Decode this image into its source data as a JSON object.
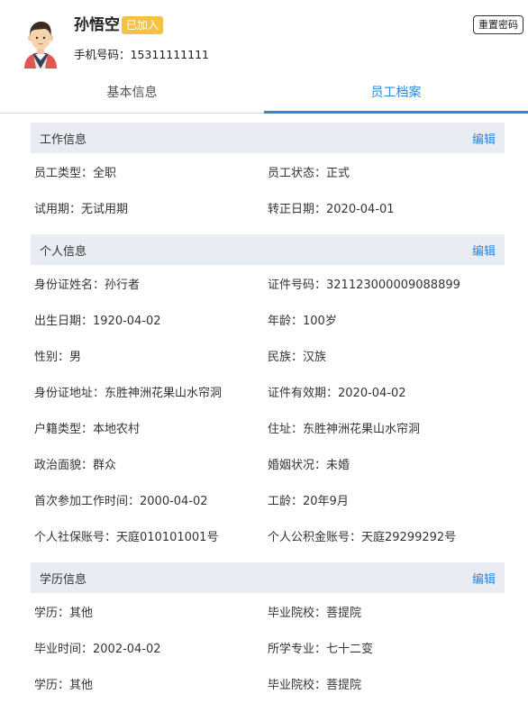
{
  "profile": {
    "name": "孙悟空",
    "badge": "已加入",
    "phone_label": "手机号码：",
    "phone": "15311111111",
    "reset_button": "重置密码"
  },
  "tabs": [
    {
      "label": "基本信息",
      "active": false
    },
    {
      "label": "员工档案",
      "active": true
    }
  ],
  "sections": [
    {
      "title": "工作信息",
      "edit": "编辑",
      "rows": [
        [
          "员工类型：全职",
          "员工状态：正式"
        ],
        [
          "试用期：无试用期",
          "转正日期：2020-04-01"
        ]
      ]
    },
    {
      "title": "个人信息",
      "edit": "编辑",
      "rows": [
        [
          "身份证姓名：孙行者",
          "证件号码：321123000009088899"
        ],
        [
          "出生日期：1920-04-02",
          "年龄：100岁"
        ],
        [
          "性别：男",
          "民族：汉族"
        ],
        [
          "身份证地址：东胜神洲花果山水帘洞",
          "证件有效期：2020-04-02"
        ],
        [
          "户籍类型：本地农村",
          "住址：东胜神洲花果山水帘洞"
        ],
        [
          "政治面貌：群众",
          "婚姻状况：未婚"
        ],
        [
          "首次参加工作时间：2000-04-02",
          "工龄：20年9月"
        ],
        [
          "个人社保账号：天庭010101001号",
          "个人公积金账号：天庭29299292号"
        ]
      ]
    },
    {
      "title": "学历信息",
      "edit": "编辑",
      "rows": [
        [
          "学历：其他",
          "毕业院校：菩提院"
        ],
        [
          "毕业时间：2002-04-02",
          "所学专业：七十二变"
        ],
        [
          "学历：其他",
          "毕业院校：菩提院"
        ]
      ]
    }
  ],
  "colors": {
    "accent": "#2e86d6",
    "badge": "#f5c242",
    "section_bg": "#eaecf4"
  }
}
